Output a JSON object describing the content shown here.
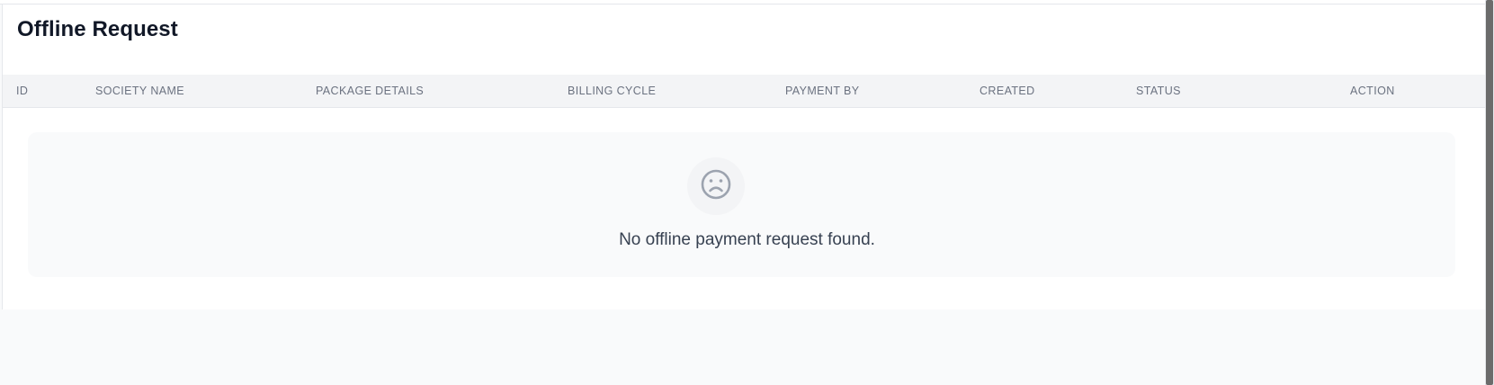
{
  "page": {
    "title": "Offline Request"
  },
  "table": {
    "columns": [
      "ID",
      "SOCIETY NAME",
      "PACKAGE DETAILS",
      "BILLING CYCLE",
      "PAYMENT BY",
      "CREATED",
      "STATUS",
      "ACTION"
    ],
    "rows": []
  },
  "empty_state": {
    "icon": "sad-face-icon",
    "message": "No offline payment request found."
  },
  "colors": {
    "header_bg": "#f3f4f6",
    "empty_bg": "#f9fafb",
    "text_muted": "#6b7280",
    "icon_color": "#9ca3af"
  }
}
